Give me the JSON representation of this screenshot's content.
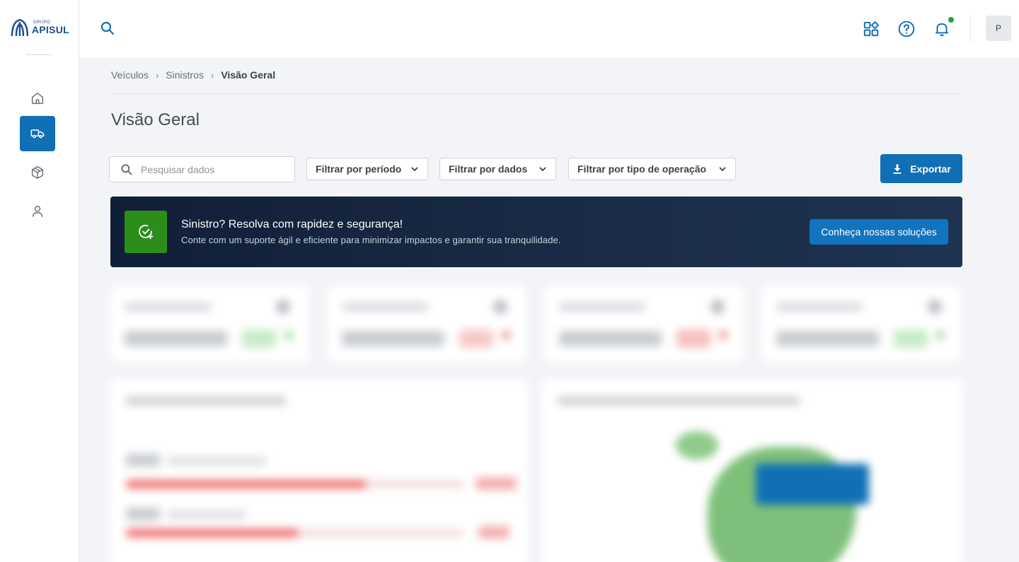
{
  "brand": {
    "logo_sup": "GRUPO",
    "logo_main": "APISUL"
  },
  "sidebar": {
    "items": [
      {
        "id": "home",
        "icon": "home-icon",
        "active": false
      },
      {
        "id": "vehicles",
        "icon": "truck-icon",
        "active": true
      },
      {
        "id": "packages",
        "icon": "package-icon",
        "active": false
      },
      {
        "id": "user",
        "icon": "user-icon",
        "active": false
      }
    ]
  },
  "topbar": {
    "icons": [
      "search-icon",
      "apps-icon",
      "help-icon",
      "bell-icon"
    ],
    "avatar_initial": "P"
  },
  "breadcrumb": {
    "items": [
      "Veículos",
      "Sinistros"
    ],
    "separator": "›",
    "current": "Visão Geral"
  },
  "page": {
    "title": "Visão Geral"
  },
  "filters": {
    "search_placeholder": "Pesquisar dados",
    "period": "Filtrar por período",
    "data": "Filtrar por dados",
    "operation": "Filtrar por tipo de operação",
    "export_label": "Exportar"
  },
  "banner": {
    "title": "Sinistro? Resolva com rapidez e segurança!",
    "subtitle": "Conte com um suporte ágil e eficiente para minimizar impactos e garantir sua tranquilidade.",
    "cta": "Conheça nossas soluções"
  },
  "colors": {
    "primary": "#106fb5",
    "banner_bg": "#101f38",
    "banner_icon_bg": "#2c8d1b",
    "notification_dot": "#1aa34a"
  }
}
